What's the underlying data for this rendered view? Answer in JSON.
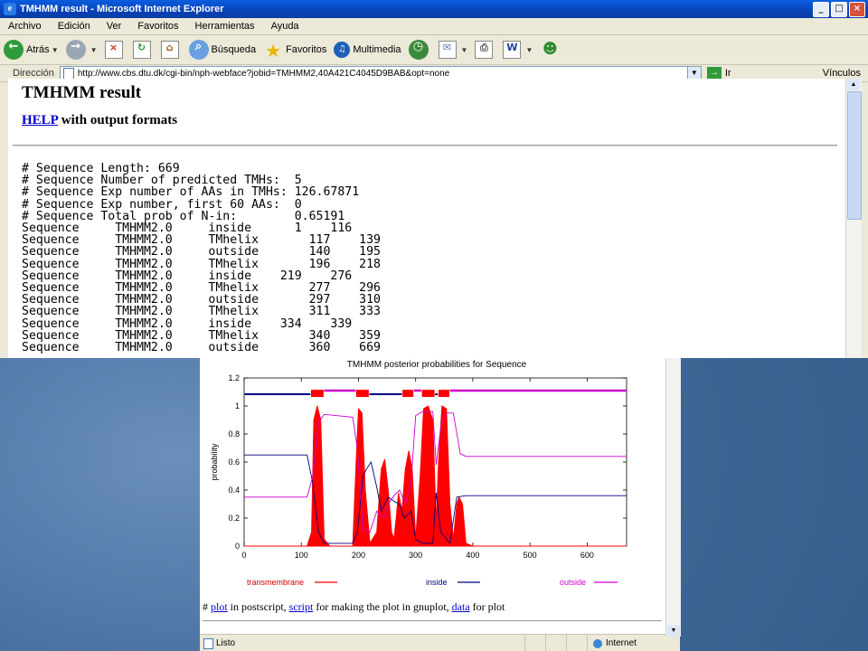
{
  "window": {
    "title": "TMHMM result - Microsoft Internet Explorer",
    "controls": [
      "_",
      "□",
      "×"
    ]
  },
  "menubar": [
    "Archivo",
    "Edición",
    "Ver",
    "Favoritos",
    "Herramientas",
    "Ayuda"
  ],
  "toolbar": {
    "back": "Atrás",
    "search": "Búsqueda",
    "favorites": "Favoritos",
    "multimedia": "Multimedia"
  },
  "address": {
    "label": "Dirección",
    "url": "http://www.cbs.dtu.dk/cgi-bin/nph-webface?jobid=TMHMM2,40A421C4045D9BAB&opt=none",
    "go": "Ir",
    "links": "Vínculos"
  },
  "page": {
    "title": "TMHMM result",
    "help_link": "HELP",
    "help_text": " with output formats",
    "output_lines": [
      "# Sequence Length: 669",
      "# Sequence Number of predicted TMHs:  5",
      "# Sequence Exp number of AAs in TMHs: 126.67871",
      "# Sequence Exp number, first 60 AAs:  0",
      "# Sequence Total prob of N-in:        0.65191",
      "Sequence     TMHMM2.0     inside      1    116",
      "Sequence     TMHMM2.0     TMhelix       117    139",
      "Sequence     TMHMM2.0     outside       140    195",
      "Sequence     TMHMM2.0     TMhelix       196    218",
      "Sequence     TMHMM2.0     inside    219    276",
      "Sequence     TMHMM2.0     TMhelix       277    296",
      "Sequence     TMHMM2.0     outside       297    310",
      "Sequence     TMHMM2.0     TMhelix       311    333",
      "Sequence     TMHMM2.0     inside    334    339",
      "Sequence     TMHMM2.0     TMhelix       340    359",
      "Sequence     TMHMM2.0     outside       360    669"
    ]
  },
  "chart_data": {
    "type": "line",
    "title": "TMHMM posterior probabilities for Sequence",
    "xlabel": "",
    "ylabel": "probability",
    "xlim": [
      0,
      669
    ],
    "ylim": [
      0,
      1.2
    ],
    "xticks": [
      0,
      100,
      200,
      300,
      400,
      500,
      600
    ],
    "yticks": [
      0,
      0.2,
      0.4,
      0.6,
      0.8,
      1,
      1.2
    ],
    "legend_position": "bottom",
    "series": [
      {
        "name": "transmembrane",
        "color": "#ff0000",
        "fill": true,
        "points": [
          [
            0,
            0
          ],
          [
            110,
            0
          ],
          [
            118,
            0.1
          ],
          [
            122,
            0.9
          ],
          [
            128,
            1.0
          ],
          [
            134,
            0.9
          ],
          [
            140,
            0.05
          ],
          [
            150,
            0
          ],
          [
            190,
            0
          ],
          [
            196,
            0.6
          ],
          [
            200,
            0.98
          ],
          [
            206,
            0.95
          ],
          [
            212,
            0.4
          ],
          [
            220,
            0.02
          ],
          [
            232,
            0.1
          ],
          [
            240,
            0.55
          ],
          [
            246,
            0.62
          ],
          [
            252,
            0.4
          ],
          [
            258,
            0.1
          ],
          [
            262,
            0.05
          ],
          [
            266,
            0.2
          ],
          [
            270,
            0.38
          ],
          [
            276,
            0.25
          ],
          [
            282,
            0.55
          ],
          [
            288,
            0.68
          ],
          [
            294,
            0.55
          ],
          [
            300,
            0.05
          ],
          [
            308,
            0.5
          ],
          [
            314,
            0.98
          ],
          [
            322,
            1.0
          ],
          [
            330,
            0.9
          ],
          [
            336,
            0.15
          ],
          [
            340,
            0.6
          ],
          [
            346,
            1.0
          ],
          [
            354,
            0.98
          ],
          [
            360,
            0.3
          ],
          [
            366,
            0.05
          ],
          [
            372,
            0.3
          ],
          [
            376,
            0.35
          ],
          [
            382,
            0.3
          ],
          [
            388,
            0.02
          ],
          [
            400,
            0
          ],
          [
            669,
            0
          ]
        ]
      },
      {
        "name": "inside",
        "color": "#000080",
        "points": [
          [
            0,
            0.65
          ],
          [
            110,
            0.65
          ],
          [
            120,
            0.45
          ],
          [
            130,
            0.1
          ],
          [
            140,
            0.02
          ],
          [
            190,
            0.02
          ],
          [
            198,
            0.1
          ],
          [
            208,
            0.5
          ],
          [
            214,
            0.55
          ],
          [
            222,
            0.6
          ],
          [
            232,
            0.42
          ],
          [
            240,
            0.25
          ],
          [
            252,
            0.35
          ],
          [
            262,
            0.32
          ],
          [
            272,
            0.3
          ],
          [
            280,
            0.2
          ],
          [
            292,
            0.25
          ],
          [
            300,
            0.05
          ],
          [
            312,
            0.02
          ],
          [
            330,
            0.02
          ],
          [
            336,
            0.38
          ],
          [
            344,
            0.1
          ],
          [
            360,
            0.02
          ],
          [
            372,
            0.35
          ],
          [
            388,
            0.36
          ],
          [
            669,
            0.36
          ]
        ]
      },
      {
        "name": "outside",
        "color": "#cc00cc",
        "points": [
          [
            0,
            0.35
          ],
          [
            110,
            0.35
          ],
          [
            120,
            0.5
          ],
          [
            130,
            0.88
          ],
          [
            140,
            0.94
          ],
          [
            190,
            0.92
          ],
          [
            198,
            0.7
          ],
          [
            208,
            0.12
          ],
          [
            220,
            0.1
          ],
          [
            232,
            0.25
          ],
          [
            244,
            0.2
          ],
          [
            252,
            0.3
          ],
          [
            262,
            0.36
          ],
          [
            272,
            0.4
          ],
          [
            282,
            0.3
          ],
          [
            292,
            0.45
          ],
          [
            300,
            0.93
          ],
          [
            312,
            0.96
          ],
          [
            330,
            0.96
          ],
          [
            336,
            0.58
          ],
          [
            344,
            0.85
          ],
          [
            352,
            0.95
          ],
          [
            366,
            0.95
          ],
          [
            378,
            0.66
          ],
          [
            388,
            0.64
          ],
          [
            669,
            0.64
          ]
        ]
      }
    ],
    "topology_bar": {
      "segments": [
        {
          "type": "inside",
          "start": 1,
          "end": 116
        },
        {
          "type": "TMhelix",
          "start": 117,
          "end": 139
        },
        {
          "type": "outside",
          "start": 140,
          "end": 195
        },
        {
          "type": "TMhelix",
          "start": 196,
          "end": 218
        },
        {
          "type": "inside",
          "start": 219,
          "end": 276
        },
        {
          "type": "TMhelix",
          "start": 277,
          "end": 296
        },
        {
          "type": "outside",
          "start": 297,
          "end": 310
        },
        {
          "type": "TMhelix",
          "start": 311,
          "end": 333
        },
        {
          "type": "inside",
          "start": 334,
          "end": 339
        },
        {
          "type": "TMhelix",
          "start": 340,
          "end": 359
        },
        {
          "type": "outside",
          "start": 360,
          "end": 669
        }
      ]
    }
  },
  "plot_links": {
    "hash": "# ",
    "plot": "plot",
    "t1": " in postscript, ",
    "script": "script",
    "t2": " for making the plot in gnuplot, ",
    "data": "data",
    "t3": " for plot"
  },
  "status": {
    "left": "Listo",
    "zone": "Internet"
  }
}
